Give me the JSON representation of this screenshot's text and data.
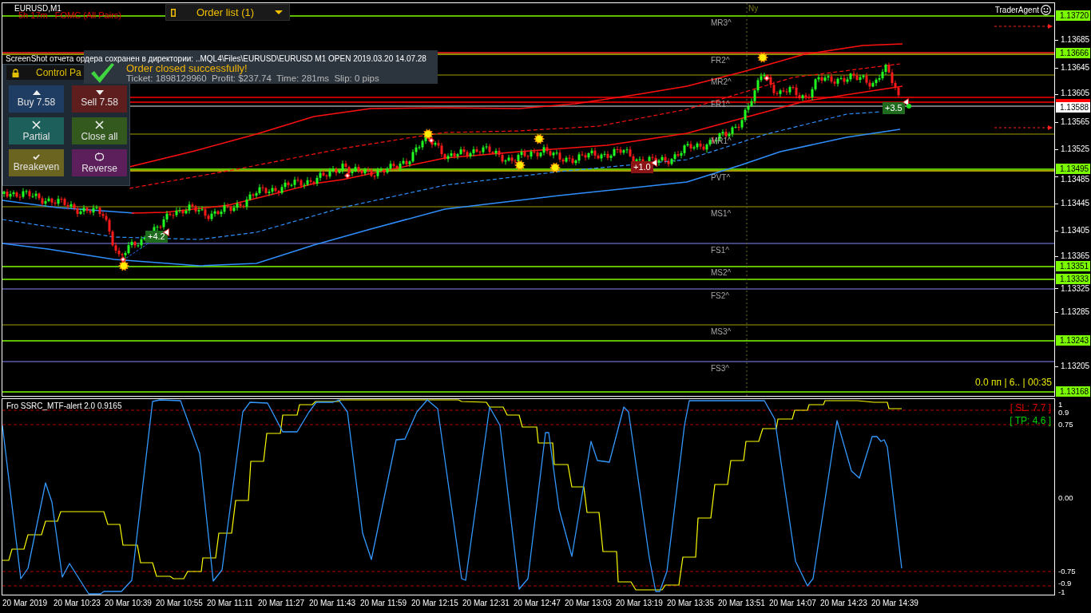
{
  "chart": {
    "symbol": "EURUSD,M1",
    "news_countdown": "5h 17m   FOMC (All Pairs)",
    "session_label": "Ny",
    "brand": "TraderAgent",
    "status_readout": "0.0 пп | 6.. | 00:35",
    "pivot_labels": [
      "MR3^",
      "FR2^",
      "MR2^",
      "FR1^",
      "MR1^",
      "PVT^",
      "MS1^",
      "FS1^",
      "MS2^",
      "FS2^",
      "MS3^",
      "FS3^"
    ],
    "trade_labels": [
      {
        "text": "+4.2",
        "color": "#1e6b1e"
      },
      {
        "text": "+1.0",
        "color": "#8b1414"
      },
      {
        "text": "+3.5",
        "color": "#1e6b1e"
      }
    ]
  },
  "order_list": {
    "label": "Order list (1)"
  },
  "notification": {
    "title": "Order closed successfully!",
    "details": "Ticket: 1898129960  Profit: $237.74  Time: 281ms  Slip: 0 pips"
  },
  "screenshot_message": "ScreenShot отчета ордера сохранен в директории: ..MQL4\\Files\\EURUSD\\EURUSD M1 OPEN 2019.03.20 14.07.28",
  "control_panel": {
    "title": "Control Pa",
    "buttons": [
      {
        "label": "Buy 7.58",
        "kind": "buy"
      },
      {
        "label": "Sell 7.58",
        "kind": "sell"
      },
      {
        "label": "Partial",
        "kind": "partial"
      },
      {
        "label": "Close all",
        "kind": "close_all"
      },
      {
        "label": "Breakeven",
        "kind": "breakeven"
      },
      {
        "label": "Reverse",
        "kind": "reverse"
      }
    ]
  },
  "price_axis": {
    "ticks": [
      "1.13685",
      "1.13645",
      "1.13605",
      "1.13565",
      "1.13525",
      "1.13485",
      "1.13445",
      "1.13405",
      "1.13365",
      "1.13325",
      "1.13285",
      "1.13205"
    ],
    "badges": [
      {
        "label": "1.13720",
        "kind": "level"
      },
      {
        "label": "1.13666",
        "kind": "level"
      },
      {
        "label": "1.13588",
        "kind": "current"
      },
      {
        "label": "1.13495",
        "kind": "level"
      },
      {
        "label": "1.13351",
        "kind": "level"
      },
      {
        "label": "1.13333",
        "kind": "level"
      },
      {
        "label": "1.13243",
        "kind": "level"
      },
      {
        "label": "1.13168",
        "kind": "level"
      }
    ]
  },
  "indicator": {
    "title": "Fro SSRC_MTF-alert 2.0 0.9165",
    "stop_loss": "[ SL: 7.7 ]",
    "take_profit": "[ TP: 4.6 ]",
    "axis_ticks": [
      "1",
      "0.9",
      "0.75",
      "0.00",
      "-0.75",
      "-0.9",
      "-1"
    ]
  },
  "time_axis": [
    "20 Mar 2019",
    "20 Mar 10:23",
    "20 Mar 10:39",
    "20 Mar 10:55",
    "20 Mar 11:11",
    "20 Mar 11:27",
    "20 Mar 11:43",
    "20 Mar 11:59",
    "20 Mar 12:15",
    "20 Mar 12:31",
    "20 Mar 12:47",
    "20 Mar 13:03",
    "20 Mar 13:19",
    "20 Mar 13:35",
    "20 Mar 13:51",
    "20 Mar 14:07",
    "20 Mar 14:23",
    "20 Mar 14:39"
  ]
}
